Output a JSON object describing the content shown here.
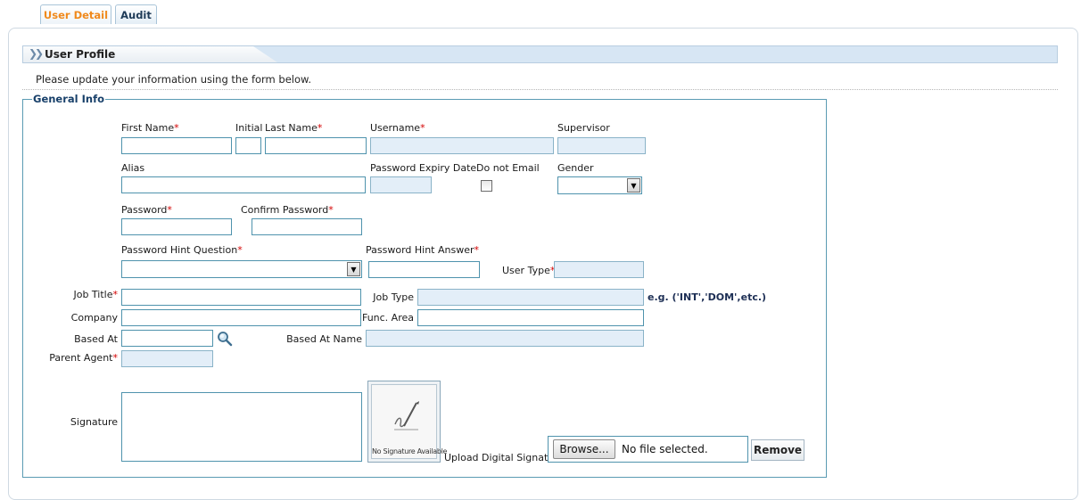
{
  "tabs": [
    {
      "label": "User Detail",
      "active": true
    },
    {
      "label": "Audit",
      "active": false
    }
  ],
  "panel": {
    "title": "User Profile",
    "intro": "Please update your information using the form below."
  },
  "general": {
    "legend": "General Info",
    "required_mark": "*",
    "labels": {
      "first_name": "First Name",
      "initial": "Initial",
      "last_name": "Last Name",
      "username": "Username",
      "supervisor": "Supervisor",
      "alias": "Alias",
      "password_expiry_date": "Password Expiry Date",
      "do_not_email": "Do not Email",
      "gender": "Gender",
      "password": "Password",
      "confirm_password": "Confirm Password",
      "hint_question": "Password Hint Question",
      "hint_answer": "Password Hint Answer",
      "user_type": "User Type",
      "job_title": "Job Title",
      "job_type": "Job Type",
      "job_type_example": "e.g. ('INT','DOM',etc.)",
      "company": "Company",
      "func_area": "Func. Area",
      "based_at": "Based At",
      "based_at_name": "Based At Name",
      "parent_agent": "Parent Agent",
      "signature": "Signature",
      "upload_signature": "Upload Digital Signature"
    },
    "values": {
      "first_name": "",
      "initial": "",
      "last_name": "",
      "username": "",
      "supervisor": "",
      "alias": "",
      "password_expiry_date": "",
      "do_not_email": false,
      "gender": "",
      "password": "",
      "confirm_password": "",
      "hint_question": "",
      "hint_answer": "",
      "user_type": "",
      "job_title": "",
      "job_type": "",
      "company": "",
      "func_area": "",
      "based_at": "",
      "based_at_name": "",
      "parent_agent": "",
      "signature": ""
    },
    "signature_placeholder": "No Signature Available",
    "file": {
      "browse_label": "Browse...",
      "status": "No file selected."
    },
    "remove_label": "Remove",
    "icons": {
      "breadcrumb": "double-chevron-right-icon",
      "lookup": "magnifier-icon",
      "signature": "pen-signature-icon",
      "dropdown": "chevron-down-icon"
    }
  },
  "colors": {
    "tab_active": "#f08a1c",
    "required": "#d40000",
    "border": "#4f93ad",
    "readonly_bg": "#e3eef8",
    "header_bg": "#d7e6f4"
  }
}
